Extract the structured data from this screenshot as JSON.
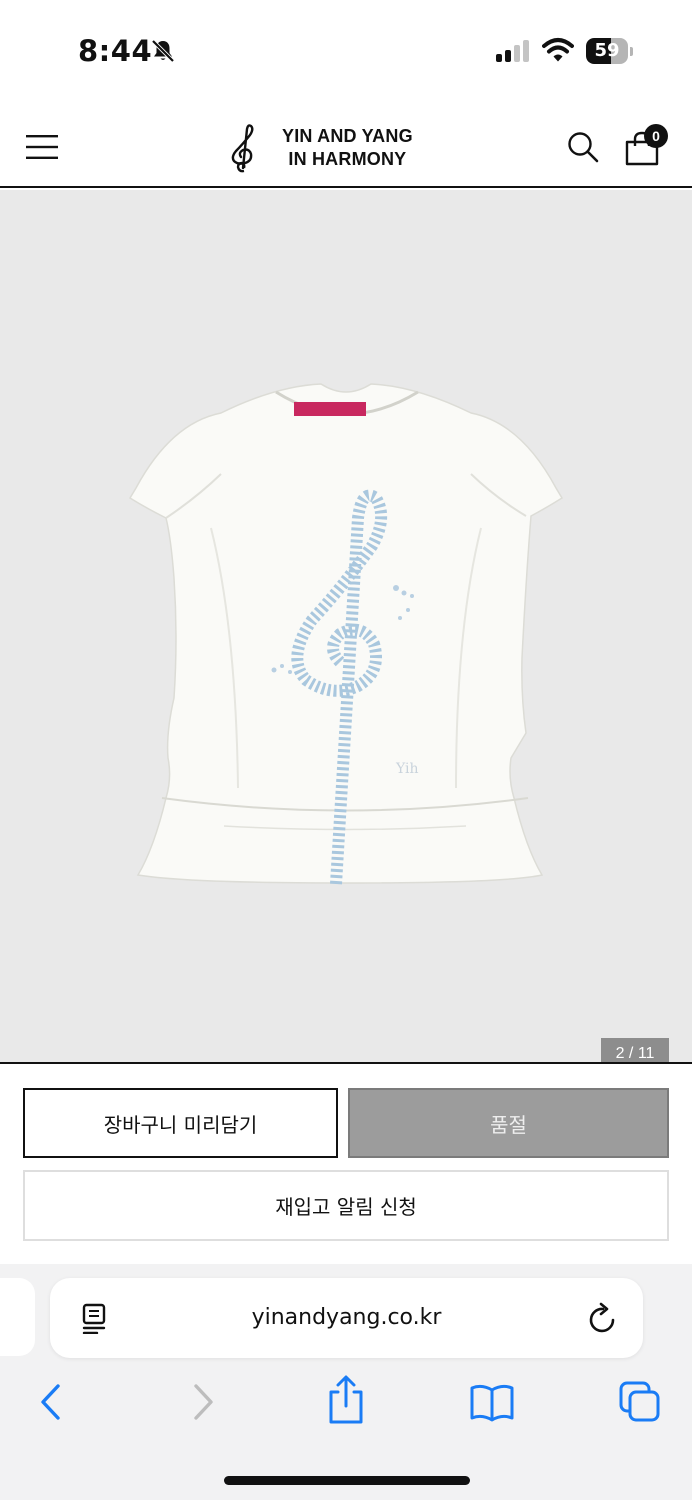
{
  "status_bar": {
    "time": "8:44",
    "battery_level": "59",
    "battery_fraction": 0.59
  },
  "header": {
    "brand_line1": "YIN AND YANG",
    "brand_line2": "IN HARMONY",
    "cart_count": "0",
    "icons": [
      "menu-icon",
      "treble-clef-logo",
      "search-icon",
      "shopping-bag-icon"
    ]
  },
  "gallery": {
    "counter": "2 / 11",
    "background_color": "#e9e9e9"
  },
  "actions": {
    "add_to_cart": "장바구니 미리담기",
    "sold_out": "품절",
    "restock_alert": "재입고 알림 신청"
  },
  "browser": {
    "url": "yinandyang.co.kr",
    "icons": [
      "reader-icon",
      "reload-icon",
      "back-icon",
      "forward-icon",
      "share-icon",
      "bookmarks-icon",
      "tabs-icon"
    ],
    "accent_color": "#1a7cf5"
  }
}
